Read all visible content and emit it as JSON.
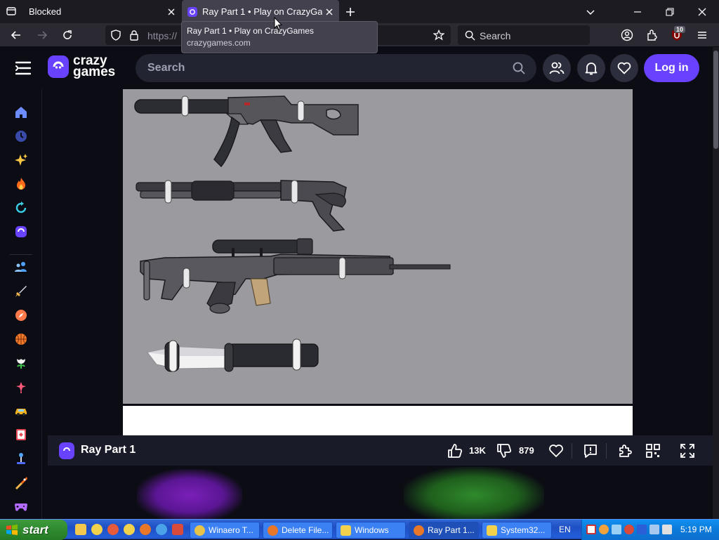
{
  "browser": {
    "tabs": [
      {
        "label": "Blocked"
      },
      {
        "label": "Ray Part 1 • Play on CrazyGames"
      }
    ],
    "url_partial": "https://",
    "search_placeholder": "Search",
    "extensions_badge": "10",
    "tooltip": {
      "title": "Ray Part 1 • Play on CrazyGames",
      "url": "crazygames.com"
    }
  },
  "site": {
    "logo_line1": "crazy",
    "logo_line2": "games",
    "search_placeholder": "Search",
    "login_label": "Log in",
    "accent_color": "#6842ff",
    "sidebar_icons": [
      "home-icon",
      "recent-icon",
      "new-icon",
      "trending-icon",
      "updated-icon",
      "originals-icon",
      "multiplayer-icon",
      "action-icon",
      "adventure-icon",
      "basketball-icon",
      "casual-icon",
      "clicker-icon",
      "driving-icon",
      "card-icon",
      "io-icon",
      "shooting-icon",
      "controller-icon"
    ]
  },
  "game": {
    "title": "Ray Part 1",
    "likes": "13K",
    "dislikes": "879"
  },
  "taskbar": {
    "start_label": "start",
    "windows": [
      {
        "label": "Winaero T..."
      },
      {
        "label": "Delete File..."
      },
      {
        "label": "Windows"
      },
      {
        "label": "Ray Part 1..."
      },
      {
        "label": "System32..."
      }
    ],
    "language": "EN",
    "clock": "5:19 PM"
  }
}
